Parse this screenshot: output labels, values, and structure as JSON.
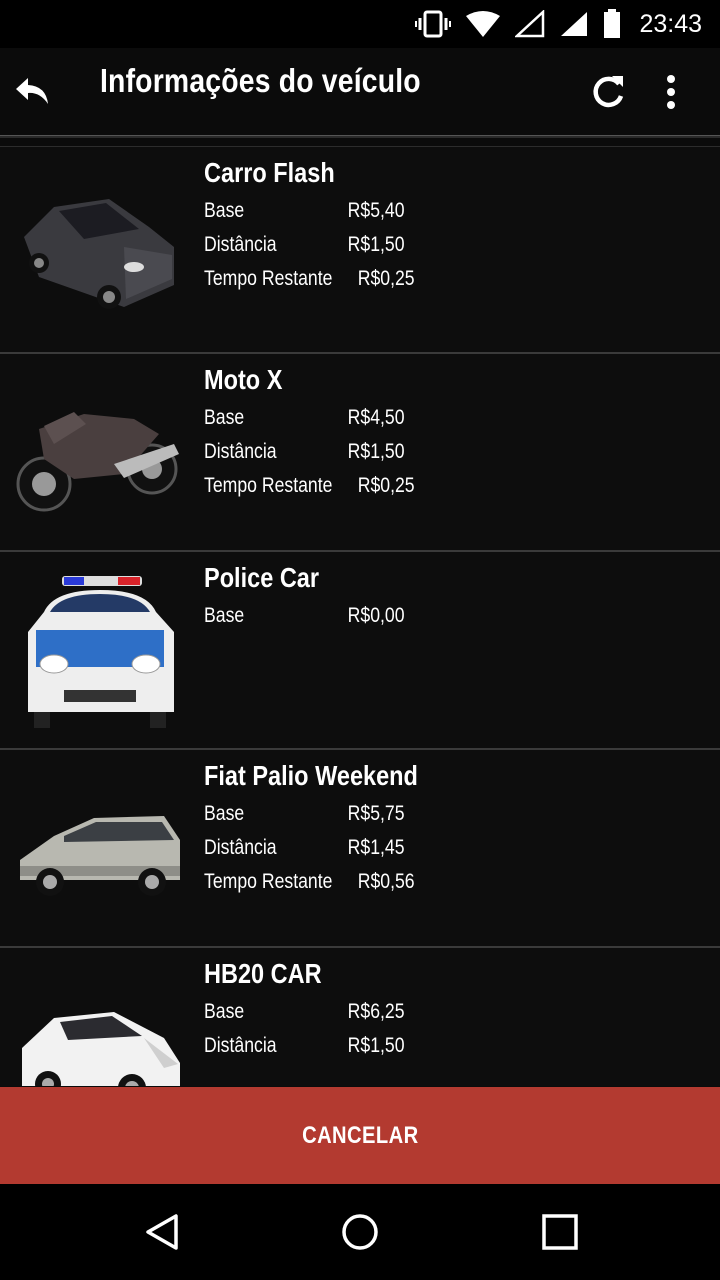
{
  "status_bar": {
    "time": "23:43"
  },
  "app_bar": {
    "title": "Informações do veículo",
    "icons": [
      "back-arrow-icon",
      "refresh-icon",
      "more-vert-icon"
    ]
  },
  "vehicles": [
    {
      "name": "Carro Flash",
      "image": "dark-hatchback-car-image",
      "fares": [
        {
          "label": "Base",
          "value": "R$5,40"
        },
        {
          "label": "Distância",
          "value": "R$1,50"
        },
        {
          "label": "Tempo Restante",
          "value": "R$0,25"
        }
      ]
    },
    {
      "name": "Moto X",
      "image": "sport-motorcycle-image",
      "fares": [
        {
          "label": "Base",
          "value": "R$4,50"
        },
        {
          "label": "Distância",
          "value": "R$1,50"
        },
        {
          "label": "Tempo Restante",
          "value": "R$0,25"
        }
      ]
    },
    {
      "name": "Police Car",
      "image": "police-car-image",
      "fares": [
        {
          "label": "Base",
          "value": "R$0,00"
        }
      ]
    },
    {
      "name": "Fiat Palio Weekend",
      "image": "silver-station-wagon-image",
      "fares": [
        {
          "label": "Base",
          "value": "R$5,75"
        },
        {
          "label": "Distância",
          "value": "R$1,45"
        },
        {
          "label": "Tempo Restante",
          "value": "R$0,56"
        }
      ]
    },
    {
      "name": "HB20 CAR",
      "image": "white-hatchback-image",
      "fares": [
        {
          "label": "Base",
          "value": "R$6,25"
        },
        {
          "label": "Distância",
          "value": "R$1,50"
        }
      ]
    }
  ],
  "cancel_button": {
    "label": "CANCELAR"
  },
  "colors": {
    "background": "#0b0b0b",
    "cancel": "#b33a30",
    "divider": "#3a3a3a"
  }
}
